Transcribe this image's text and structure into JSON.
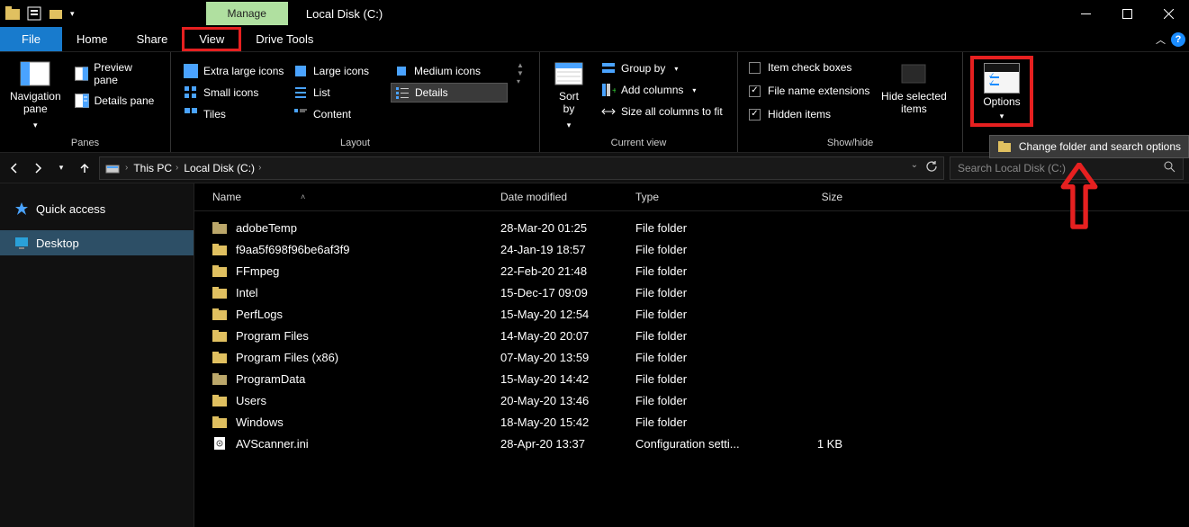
{
  "titlebar": {
    "context_tab": "Manage",
    "window_title": "Local Disk (C:)"
  },
  "tabs": {
    "file": "File",
    "home": "Home",
    "share": "Share",
    "view": "View",
    "drive_tools": "Drive Tools"
  },
  "ribbon": {
    "panes": {
      "navigation": "Navigation\npane",
      "preview": "Preview pane",
      "details": "Details pane",
      "group_label": "Panes"
    },
    "layout": {
      "extra_large": "Extra large icons",
      "large": "Large icons",
      "medium": "Medium icons",
      "small": "Small icons",
      "list": "List",
      "details": "Details",
      "tiles": "Tiles",
      "content": "Content",
      "group_label": "Layout"
    },
    "current_view": {
      "sort_by": "Sort\nby",
      "group_by": "Group by",
      "add_columns": "Add columns",
      "size_all": "Size all columns to fit",
      "group_label": "Current view"
    },
    "show_hide": {
      "item_checkboxes": "Item check boxes",
      "file_ext": "File name extensions",
      "hidden_items": "Hidden items",
      "hide_selected": "Hide selected\nitems",
      "group_label": "Show/hide"
    },
    "options": {
      "label": "Options",
      "dropdown_item": "Change folder and search options"
    }
  },
  "breadcrumb": {
    "this_pc": "This PC",
    "local_disk": "Local Disk (C:)"
  },
  "search": {
    "placeholder": "Search Local Disk (C:)"
  },
  "sidebar": {
    "quick_access": "Quick access",
    "desktop": "Desktop"
  },
  "columns": {
    "name": "Name",
    "date": "Date modified",
    "type": "Type",
    "size": "Size"
  },
  "files": [
    {
      "name": "adobeTemp",
      "date": "28-Mar-20 01:25",
      "type": "File folder",
      "size": "",
      "icon": "folder-dark"
    },
    {
      "name": "f9aa5f698f96be6af3f9",
      "date": "24-Jan-19 18:57",
      "type": "File folder",
      "size": "",
      "icon": "folder"
    },
    {
      "name": "FFmpeg",
      "date": "22-Feb-20 21:48",
      "type": "File folder",
      "size": "",
      "icon": "folder"
    },
    {
      "name": "Intel",
      "date": "15-Dec-17 09:09",
      "type": "File folder",
      "size": "",
      "icon": "folder"
    },
    {
      "name": "PerfLogs",
      "date": "15-May-20 12:54",
      "type": "File folder",
      "size": "",
      "icon": "folder"
    },
    {
      "name": "Program Files",
      "date": "14-May-20 20:07",
      "type": "File folder",
      "size": "",
      "icon": "folder"
    },
    {
      "name": "Program Files (x86)",
      "date": "07-May-20 13:59",
      "type": "File folder",
      "size": "",
      "icon": "folder"
    },
    {
      "name": "ProgramData",
      "date": "15-May-20 14:42",
      "type": "File folder",
      "size": "",
      "icon": "folder-dark"
    },
    {
      "name": "Users",
      "date": "20-May-20 13:46",
      "type": "File folder",
      "size": "",
      "icon": "folder"
    },
    {
      "name": "Windows",
      "date": "18-May-20 15:42",
      "type": "File folder",
      "size": "",
      "icon": "folder"
    },
    {
      "name": "AVScanner.ini",
      "date": "28-Apr-20 13:37",
      "type": "Configuration setti...",
      "size": "1 KB",
      "icon": "ini"
    }
  ]
}
